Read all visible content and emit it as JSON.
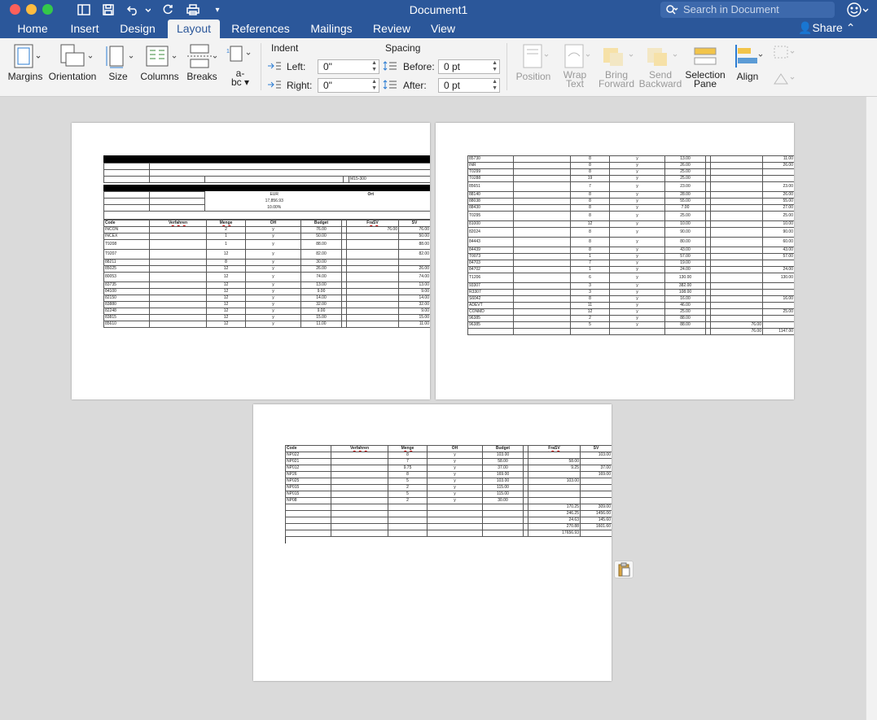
{
  "window": {
    "title": "Document1",
    "search_placeholder": "Search in Document"
  },
  "tabs": [
    "Home",
    "Insert",
    "Design",
    "Layout",
    "References",
    "Mailings",
    "Review",
    "View"
  ],
  "active_tab": "Layout",
  "share_label": "Share",
  "ribbon": {
    "margins": "Margins",
    "orientation": "Orientation",
    "size": "Size",
    "columns": "Columns",
    "breaks": "Breaks",
    "indent_title": "Indent",
    "spacing_title": "Spacing",
    "left_label": "Left:",
    "right_label": "Right:",
    "before_label": "Before:",
    "after_label": "After:",
    "left_value": "0\"",
    "right_value": "0\"",
    "before_value": "0 pt",
    "after_value": "0 pt",
    "position": "Position",
    "wrap1": "Wrap",
    "wrap2": "Text",
    "bring1": "Bring",
    "bring2": "Forward",
    "send1": "Send",
    "send2": "Backward",
    "selection1": "Selection",
    "selection2": "Pane",
    "align": "Align"
  },
  "page1": {
    "ref": "M15-300",
    "currency": "EUR",
    "amount": "17,856.93",
    "percent": "10.00%",
    "ort": "Ort",
    "headers": [
      "Code",
      "Verfahren",
      "Menge",
      "OH",
      "Budget",
      "FraSV",
      "SV"
    ],
    "rows": [
      [
        "INCON",
        "",
        "2",
        "y",
        "76.00",
        "76.00",
        "76.00"
      ],
      [
        "INCEX",
        "",
        "1",
        "y",
        "50.00",
        "",
        "50.00"
      ],
      [
        "T9208",
        "",
        "1",
        "y",
        "88.00",
        "",
        "88.00"
      ],
      [
        "T9207",
        "",
        "12",
        "y",
        "82.00",
        "",
        "82.00"
      ],
      [
        "88211",
        "",
        "8",
        "y",
        "30.00",
        "",
        ""
      ],
      [
        "85025",
        "",
        "12",
        "y",
        "26.00",
        "",
        "26.00"
      ],
      [
        "80053",
        "",
        "12",
        "y",
        "74.00",
        "",
        "74.00"
      ],
      [
        "83735",
        "",
        "12",
        "y",
        "13.00",
        "",
        "13.00"
      ],
      [
        "84100",
        "",
        "12",
        "y",
        "9.00",
        "",
        "9.00"
      ],
      [
        "82150",
        "",
        "12",
        "y",
        "14.00",
        "",
        "14.00"
      ],
      [
        "83880",
        "",
        "12",
        "y",
        "32.00",
        "",
        "32.00"
      ],
      [
        "82248",
        "",
        "12",
        "y",
        "9.00",
        "",
        "9.00"
      ],
      [
        "83815",
        "",
        "12",
        "y",
        "15.00",
        "",
        "15.00"
      ],
      [
        "85610",
        "",
        "12",
        "y",
        "11.00",
        "",
        "11.00"
      ]
    ]
  },
  "page2": {
    "rows": [
      [
        "85730",
        "",
        "8",
        "y",
        "13.00",
        "",
        "11.00"
      ],
      [
        "INR",
        "",
        "8",
        "y",
        "26.00",
        "",
        "26.00"
      ],
      [
        "T0299",
        "",
        "8",
        "y",
        "25.00",
        "",
        ""
      ],
      [
        "T0288",
        "",
        "19",
        "y",
        "25.00",
        "",
        ""
      ],
      [
        "85651",
        "",
        "7",
        "y",
        "23.00",
        "",
        "23.00"
      ],
      [
        "88140",
        "",
        "8",
        "y",
        "28.00",
        "",
        "26.00"
      ],
      [
        "88038",
        "",
        "8",
        "y",
        "55.00",
        "",
        "55.00"
      ],
      [
        "88430",
        "",
        "8",
        "y",
        "7.00",
        "",
        "27.00"
      ],
      [
        "T0295",
        "",
        "8",
        "y",
        "25.00",
        "",
        "25.00"
      ],
      [
        "81000",
        "",
        "12",
        "y",
        "10.00",
        "",
        "10.00"
      ],
      [
        "82024",
        "",
        "8",
        "y",
        "90.00",
        "",
        "90.00"
      ],
      [
        "84443",
        "",
        "8",
        "y",
        "80.00",
        "",
        "60.00"
      ],
      [
        "84439",
        "",
        "8",
        "y",
        "43.00",
        "",
        "43.00"
      ],
      [
        "T0073",
        "",
        "1",
        "y",
        "57.00",
        "",
        "57.00"
      ],
      [
        "84703",
        "",
        "7",
        "y",
        "19.00",
        "",
        ""
      ],
      [
        "84702",
        "",
        "1",
        "y",
        "24.00",
        "",
        "24.00"
      ],
      [
        "T1206",
        "",
        "6",
        "y",
        "130.00",
        "",
        "130.00"
      ],
      [
        "93307",
        "",
        "3",
        "y",
        "382.00",
        "",
        ""
      ],
      [
        "R3307",
        "",
        "3",
        "y",
        "108.00",
        "",
        ""
      ],
      [
        "S6042",
        "",
        "8",
        "y",
        "16.00",
        "",
        "16.00"
      ],
      [
        "ADEVT",
        "",
        "11",
        "y",
        "46.00",
        "",
        ""
      ],
      [
        "CONMD",
        "",
        "12",
        "y",
        "25.00",
        "",
        "25.00"
      ],
      [
        "96385",
        "",
        "2",
        "y",
        "88.00",
        "",
        ""
      ],
      [
        "96385",
        "",
        "5",
        "y",
        "88.00",
        "76.00",
        ""
      ],
      [
        "",
        "",
        "",
        "",
        "",
        "76.00",
        "1147.00"
      ]
    ]
  },
  "page3": {
    "headers": [
      "Code",
      "Verfahren",
      "Menge",
      "OH",
      "Budget",
      "FraSV",
      "SV"
    ],
    "rows": [
      [
        "NP022",
        "",
        "8",
        "y",
        "103.00",
        "",
        "103.00"
      ],
      [
        "NP021",
        "",
        "7",
        "y",
        "58.00",
        "58.00",
        ""
      ],
      [
        "NP012",
        "",
        "9.75",
        "y",
        "37.00",
        "9.25",
        "37.00"
      ],
      [
        "NP26",
        "",
        "8",
        "y",
        "169.00",
        "",
        "169.00"
      ],
      [
        "NP025",
        "",
        "5",
        "y",
        "103.00",
        "103.00",
        ""
      ],
      [
        "NP015",
        "",
        "2",
        "y",
        "115.00",
        "",
        ""
      ],
      [
        "NP015",
        "",
        "5",
        "y",
        "115.00",
        "",
        ""
      ],
      [
        "NP08",
        "",
        "2",
        "y",
        "30.00",
        "",
        ""
      ],
      [
        "",
        "",
        "",
        "",
        "",
        "170.25",
        "309.00"
      ],
      [
        "",
        "",
        "",
        "",
        "",
        "246.25",
        "1456.00"
      ],
      [
        "",
        "",
        "",
        "",
        "",
        "24.63",
        "145.60"
      ],
      [
        "",
        "",
        "",
        "",
        "",
        "270.88",
        "1601.60"
      ],
      [
        "",
        "",
        "",
        "",
        "",
        "17656.93",
        ""
      ]
    ]
  }
}
